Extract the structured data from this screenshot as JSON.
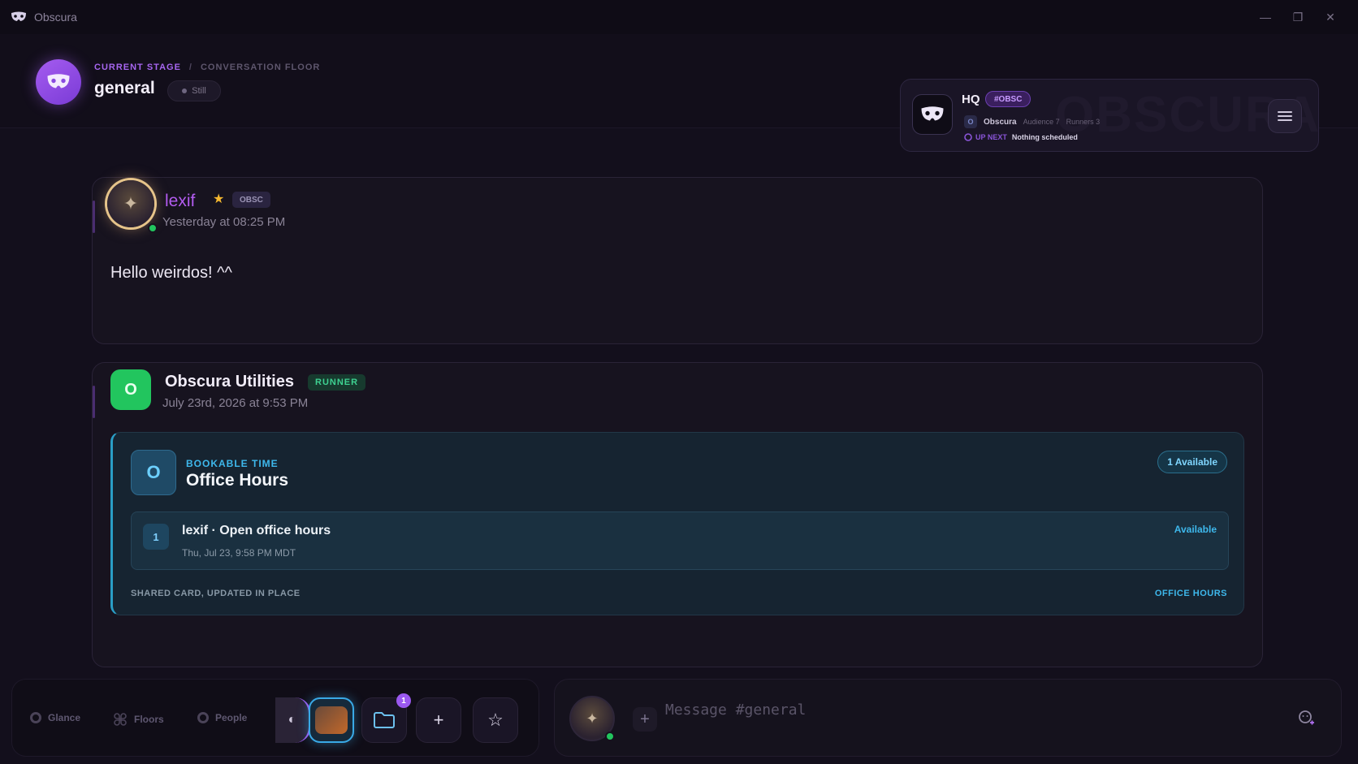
{
  "app": {
    "title": "Obscura"
  },
  "window": {
    "minimize": "—",
    "restore": "❐",
    "close": "✕"
  },
  "header": {
    "crumb_current": "CURRENT STAGE",
    "crumb_sep": "/",
    "crumb_floor": "CONVERSATION FLOOR",
    "channel": "general",
    "status": "Still"
  },
  "hq": {
    "name": "HQ",
    "tag": "#OBSC",
    "watermark": "OBSCURA",
    "server_initial": "O",
    "server_name": "Obscura",
    "audience": "Audience 7",
    "runners": "Runners 3",
    "up_next_label": "UP NEXT",
    "up_next_value": "Nothing scheduled"
  },
  "messages": [
    {
      "author": "lexif",
      "badge": "OBSC",
      "timestamp": "Yesterday at 08:25 PM",
      "text": "Hello weirdos! ^^"
    },
    {
      "avatar_initial": "O",
      "author": "Obscura Utilities",
      "badge": "RUNNER",
      "timestamp": "July 23rd, 2026 at 9:53 PM",
      "card": {
        "icon_letter": "O",
        "eyebrow": "BOOKABLE TIME",
        "title": "Office Hours",
        "availability": "1 Available",
        "slot": {
          "number": "1",
          "title": "lexif · Open office hours",
          "time": "Thu, Jul 23, 9:58 PM MDT",
          "status": "Available"
        },
        "footer_left": "SHARED CARD, UPDATED IN PLACE",
        "footer_right": "OFFICE HOURS"
      }
    }
  ],
  "nav": {
    "glance": "Glance",
    "floors": "Floors",
    "people": "People"
  },
  "dock": {
    "folder_badge": "1",
    "add": "+",
    "favorite": "☆"
  },
  "composer": {
    "placeholder": "Message #general",
    "attach": "+"
  },
  "icons": {
    "app_logo": "mask-icon",
    "menu": "hamburger-icon",
    "emoji": "emoji-icon",
    "folder": "folder-icon",
    "star": "star-icon"
  },
  "colors": {
    "accent": "#a766f0",
    "online": "#22c55e",
    "booking": "#3eb8ec",
    "runner": "#3ed191"
  }
}
